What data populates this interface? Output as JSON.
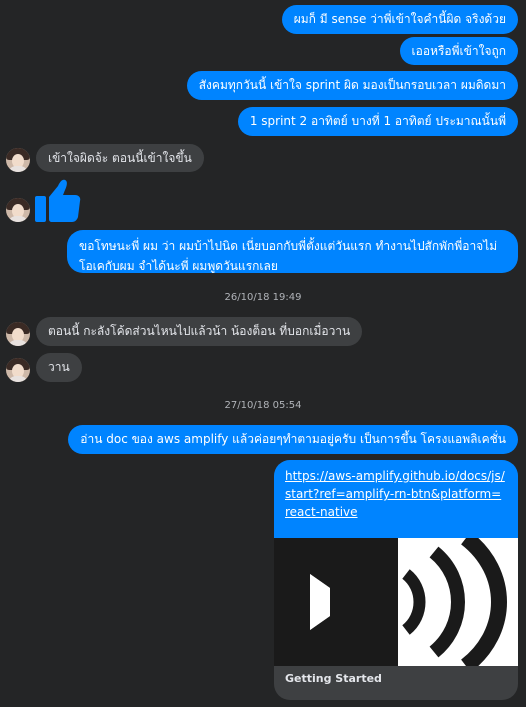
{
  "messages": {
    "m1": "ผมก็ มี sense ว่าพี่เข้าใจคำนี้ผิด จริงด้วย",
    "m2": "เออหรือพี่เข้าใจถูก",
    "m3": "สังคมทุกวันนี้ เข้าใจ sprint ผิด มองเป็นกรอบเวลา ผมดิดมา",
    "m4": "1 sprint 2 อาทิตย์ บางที่ 1 อาทิตย์ ประมาณนั้นพี่",
    "m5": "เข้าใจผิดจ้ะ ตอนนี้เข้าใจขึ้น",
    "m6": "ขอโทษนะพี่ ผม ว่า ผมบ้าไปนิด เนี่ยบอกกับพี่ตั้งแต่วันแรก ทำงานไปสักพักพี่อาจไม่โอเคกับผม จำได้นะพี่ ผมพูดวันแรกเลย",
    "m7": "ตอนนี้ กะลังโค้ดส่วนไหนไปแล้วน้า น้องต็อน ที่บอกเมื่อวาน",
    "m8": "วาน",
    "m9": "อ่าน doc ของ aws amplify แล้วค่อยๆทำตามอยู่ครับ เป็นการขึ้น โครงแอพลิเคชั่น"
  },
  "timestamps": {
    "t1": "26/10/18 19:49",
    "t2": "27/10/18 05:54"
  },
  "link_card": {
    "url": "https://aws-amplify.github.io/docs/js/start?ref=amplify-rn-btn&platform=react-native",
    "title": "Getting Started"
  },
  "colors": {
    "outgoing_bubble": "#0084ff",
    "incoming_bubble": "#3e4042",
    "background": "#242526"
  },
  "icons": {
    "like": "thumbs-up-icon",
    "link_preview": "speaker-volume-icon"
  }
}
